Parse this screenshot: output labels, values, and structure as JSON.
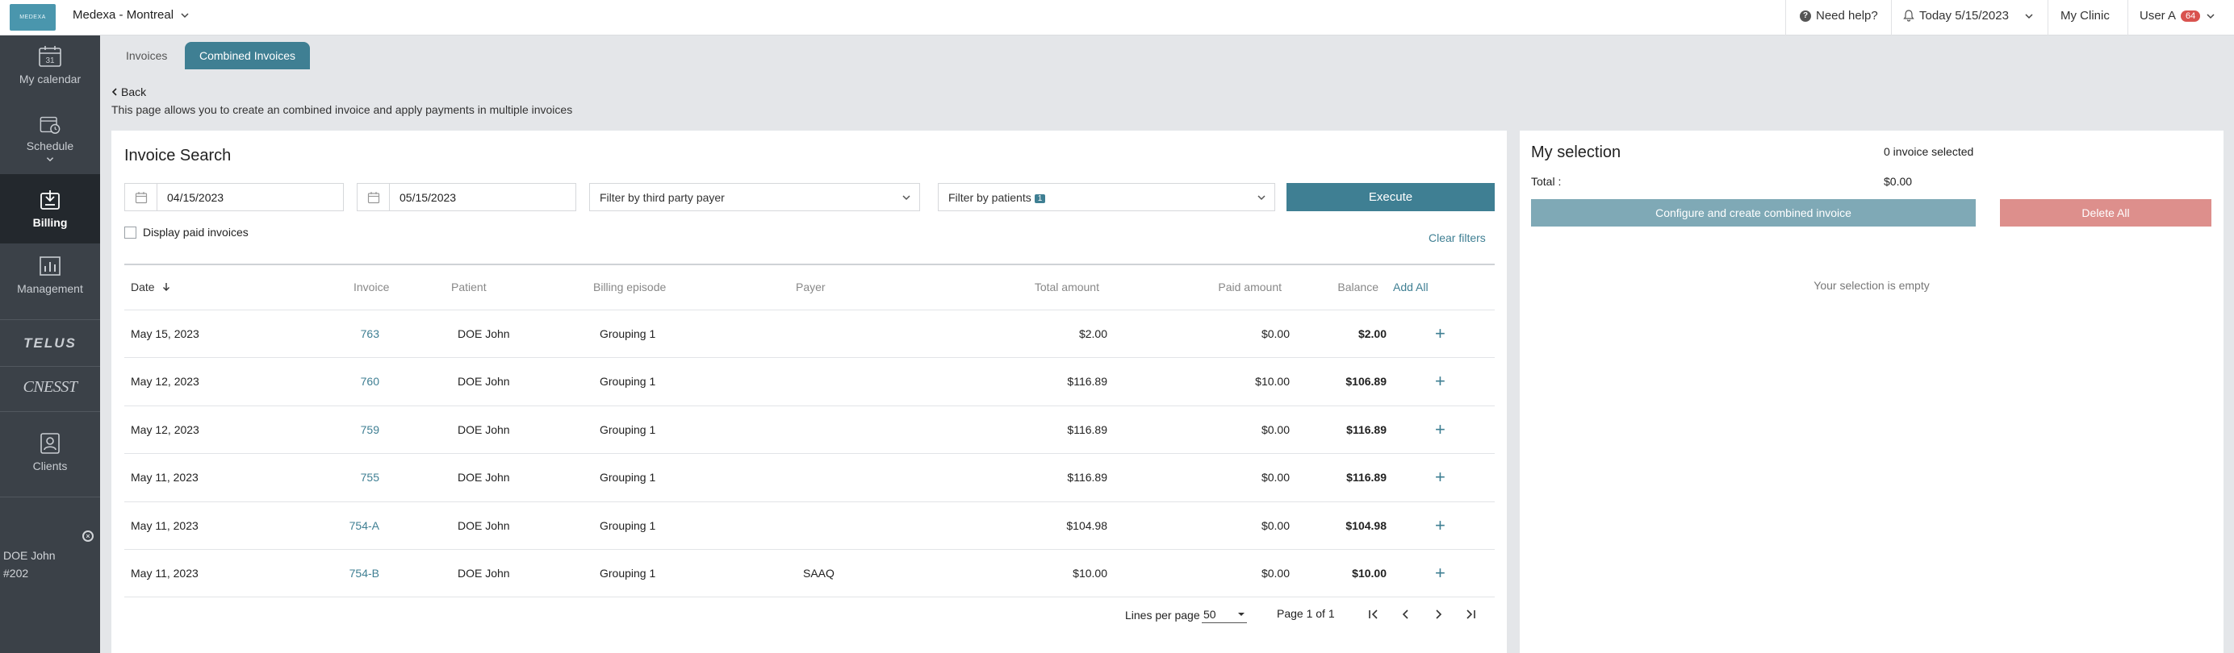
{
  "topbar": {
    "logo_text": "MEDEXA",
    "clinic_name": "Medexa - Montreal",
    "help": "Need help?",
    "today": "Today 5/15/2023",
    "my_clinic": "My Clinic",
    "user": "User A",
    "user_badge": "64"
  },
  "sidebar": {
    "items": [
      {
        "label": "My calendar",
        "icon": "calendar-icon"
      },
      {
        "label": "Schedule",
        "icon": "clock-calendar-icon"
      },
      {
        "label": "Billing",
        "icon": "billing-icon"
      },
      {
        "label": "Management",
        "icon": "chart-icon"
      },
      {
        "label": "Clients",
        "icon": "clients-icon"
      }
    ],
    "calendar_day": "31",
    "partners": [
      "TELUS",
      "CNESST"
    ],
    "patient_name": "DOE John",
    "patient_id": "#202"
  },
  "tabs": [
    {
      "label": "Invoices"
    },
    {
      "label": "Combined Invoices"
    }
  ],
  "page": {
    "back": "Back",
    "description": "This page allows you to create an combined invoice and apply payments in multiple invoices"
  },
  "search": {
    "title": "Invoice Search",
    "date_from": "04/15/2023",
    "date_to": "05/15/2023",
    "third_party_placeholder": "Filter by third party payer",
    "patients_label": "Filter by patients",
    "patients_count": "1",
    "execute": "Execute",
    "display_paid": "Display paid invoices",
    "clear_filters": "Clear filters"
  },
  "table": {
    "headers": {
      "date": "Date",
      "invoice": "Invoice",
      "patient": "Patient",
      "billing_episode": "Billing episode",
      "payer": "Payer",
      "total": "Total amount",
      "paid": "Paid amount",
      "balance": "Balance",
      "add_all": "Add All"
    },
    "rows": [
      {
        "date": "May 15, 2023",
        "invoice": "763",
        "patient": "DOE John",
        "episode": "Grouping 1",
        "payer": "",
        "total": "$2.00",
        "paid": "$0.00",
        "balance": "$2.00"
      },
      {
        "date": "May 12, 2023",
        "invoice": "760",
        "patient": "DOE John",
        "episode": "Grouping 1",
        "payer": "",
        "total": "$116.89",
        "paid": "$10.00",
        "balance": "$106.89"
      },
      {
        "date": "May 12, 2023",
        "invoice": "759",
        "patient": "DOE John",
        "episode": "Grouping 1",
        "payer": "",
        "total": "$116.89",
        "paid": "$0.00",
        "balance": "$116.89"
      },
      {
        "date": "May 11, 2023",
        "invoice": "755",
        "patient": "DOE John",
        "episode": "Grouping 1",
        "payer": "",
        "total": "$116.89",
        "paid": "$0.00",
        "balance": "$116.89"
      },
      {
        "date": "May 11, 2023",
        "invoice": "754-A",
        "patient": "DOE John",
        "episode": "Grouping 1",
        "payer": "",
        "total": "$104.98",
        "paid": "$0.00",
        "balance": "$104.98"
      },
      {
        "date": "May 11, 2023",
        "invoice": "754-B",
        "patient": "DOE John",
        "episode": "Grouping 1",
        "payer": "SAAQ",
        "total": "$10.00",
        "paid": "$0.00",
        "balance": "$10.00"
      }
    ]
  },
  "pagination": {
    "lines_label": "Lines per page",
    "lines_value": "50",
    "page_text": "Page 1 of 1"
  },
  "selection": {
    "title": "My selection",
    "count_text": "0 invoice selected",
    "total_label": "Total :",
    "total_value": "$0.00",
    "configure_button": "Configure and create combined invoice",
    "delete_all": "Delete All",
    "empty": "Your selection is empty"
  },
  "colors": {
    "accent": "#3f7f93",
    "sidebar": "#3b4148",
    "sidebar_active": "#23282d",
    "danger_light": "#dd8f8c"
  }
}
